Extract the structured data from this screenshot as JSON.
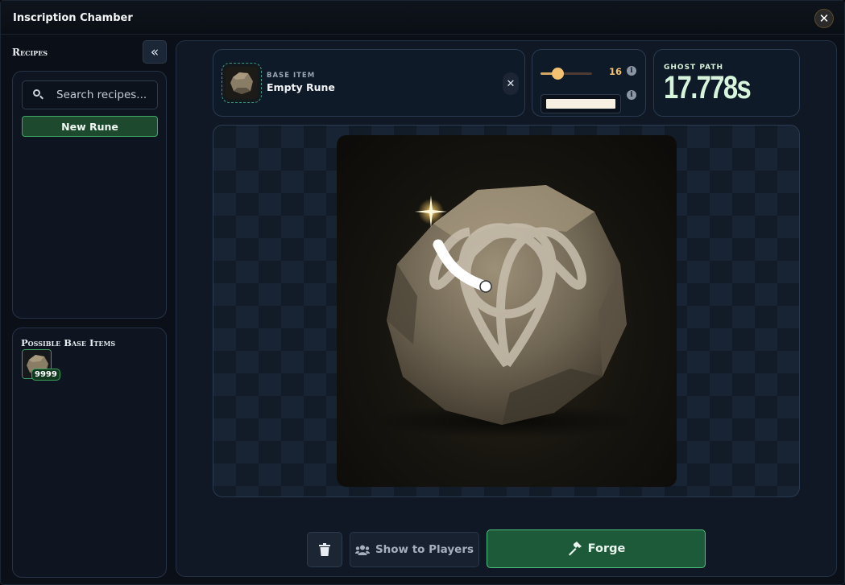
{
  "window": {
    "title": "Inscription Chamber",
    "close_icon": "close-icon"
  },
  "sidebar": {
    "heading": "Recipes",
    "collapse_icon": "double-chevron-left-icon",
    "search": {
      "placeholder": "Search recipes...",
      "value": ""
    },
    "new_rune_label": "New Rune",
    "base_items": {
      "heading": "Possible Base Items",
      "items": [
        {
          "icon": "stone-rune-icon",
          "quantity": "9999"
        }
      ]
    }
  },
  "toolbar": {
    "base_item": {
      "label": "BASE ITEM",
      "name": "Empty Rune",
      "clear_icon": "close-icon"
    },
    "brush": {
      "size": "16",
      "color": "#f6efe2"
    },
    "ghost_path": {
      "label": "GHOST PATH",
      "value": "17.778s"
    }
  },
  "actions": {
    "trash_icon": "trash-icon",
    "show_label": "Show to Players",
    "show_icon": "users-icon",
    "forge_label": "Forge",
    "forge_icon": "hammer-icon"
  },
  "colors": {
    "accent_green": "#3fa864",
    "accent_gold": "#f2c171",
    "ghost_text": "#d7f5dc"
  }
}
